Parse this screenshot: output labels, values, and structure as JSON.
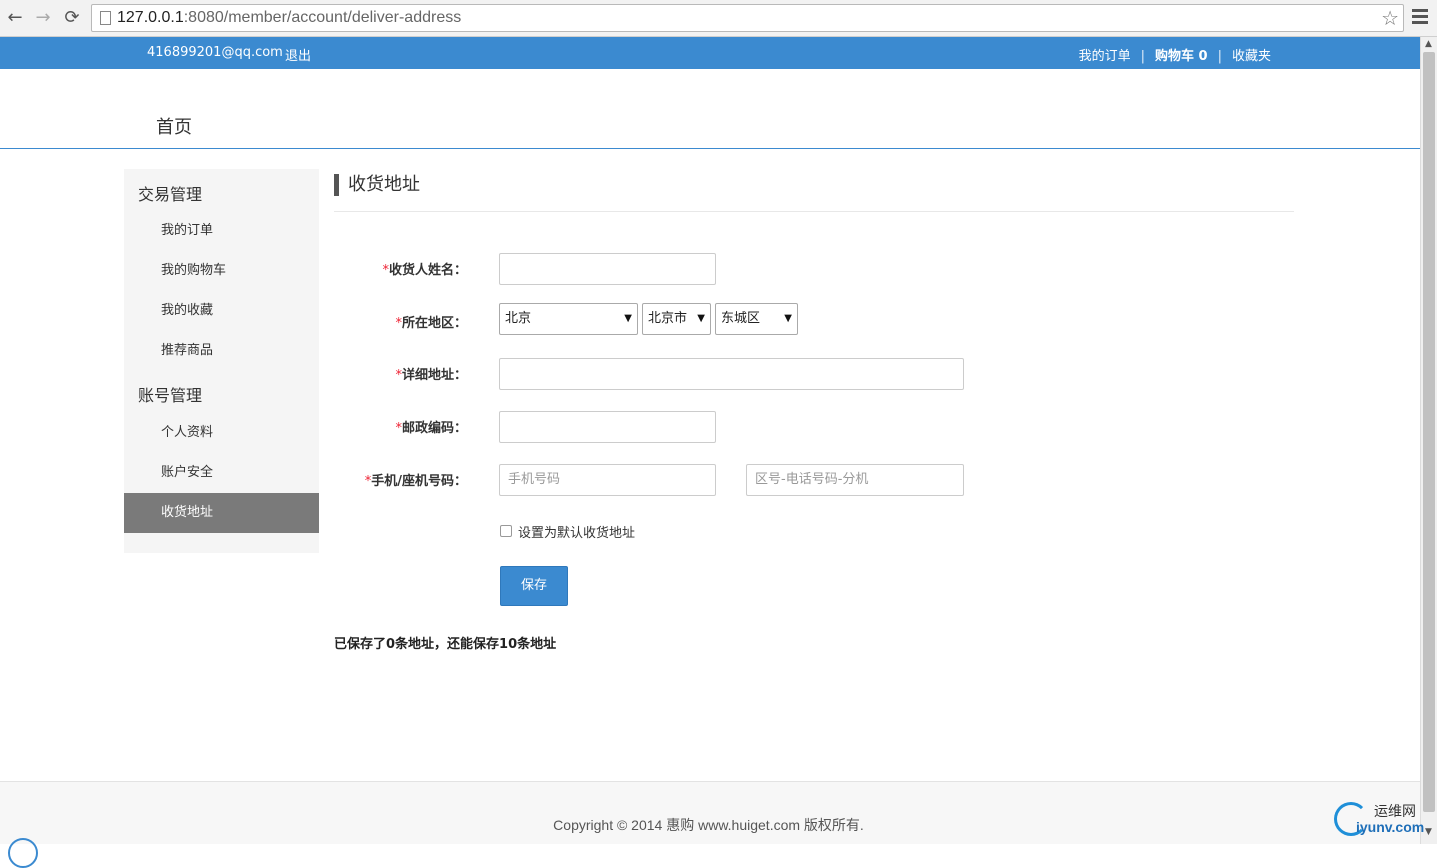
{
  "browser": {
    "url_host": "127.0.0.1",
    "url_rest": ":8080/member/account/deliver-address",
    "back_icon": "←",
    "forward_icon": "→",
    "reload_icon": "⟳",
    "star_icon": "☆"
  },
  "topbar": {
    "user_email": "416899201@qq.com",
    "logout": "退出",
    "links": [
      "我的订单",
      "购物车 0",
      "收藏夹"
    ],
    "separator": "|",
    "bg_color": "#3b8ad0"
  },
  "header": {
    "home": "首页"
  },
  "sidebar": {
    "groups": [
      {
        "title": "交易管理",
        "items": [
          "我的订单",
          "我的购物车",
          "我的收藏",
          "推荐商品"
        ]
      },
      {
        "title": "账号管理",
        "items": [
          "个人资料",
          "账户安全",
          "收货地址"
        ]
      }
    ],
    "active_item": "收货地址"
  },
  "main": {
    "title": "收货地址",
    "form": {
      "required_mark": "*",
      "name_label": "收货人姓名：",
      "region_label": "所在地区：",
      "province": "北京",
      "city": "北京市",
      "district": "东城区",
      "address_label": "详细地址：",
      "zip_label": "邮政编码：",
      "phone_label": "手机/座机号码：",
      "mobile_placeholder": "手机号码",
      "tel_placeholder": "区号-电话号码-分机",
      "default_checkbox": "设置为默认收货地址",
      "save_button": "保存"
    },
    "saved_note": "已保存了0条地址，还能保存10条地址"
  },
  "footer": {
    "copyright": "Copyright © 2014 惠购 www.huiget.com 版权所有."
  },
  "watermark": {
    "cn": "运维网",
    "en": "iyunv.com"
  }
}
